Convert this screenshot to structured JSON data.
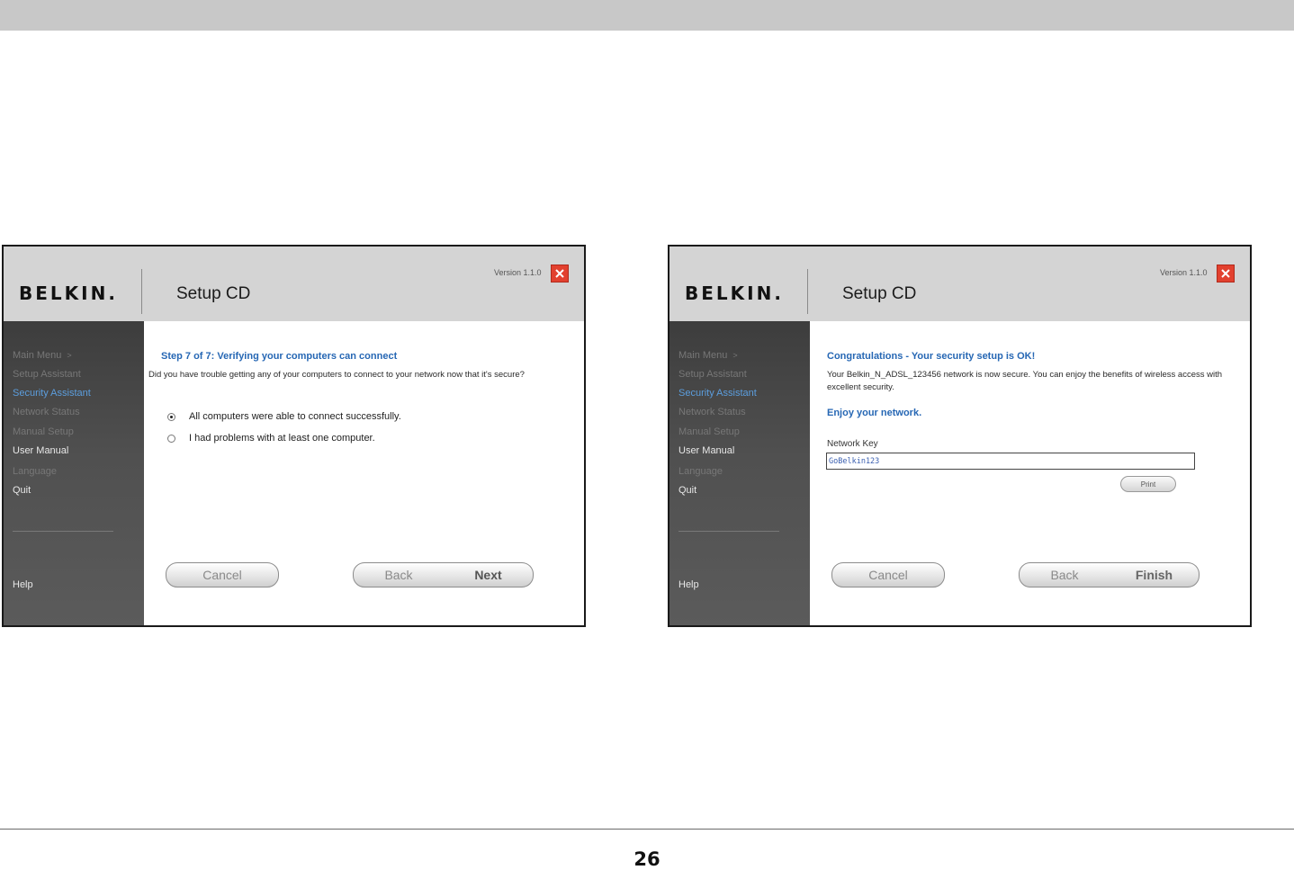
{
  "page_number": "26",
  "windows": [
    {
      "logo": "BELKIN.",
      "title": "Setup CD",
      "version": "Version 1.1.0",
      "sidebar": {
        "items": [
          {
            "label": "Main Menu",
            "arrow": ">"
          },
          {
            "label": "Setup Assistant"
          },
          {
            "label": "Security Assistant"
          },
          {
            "label": "Network Status"
          },
          {
            "label": "Manual Setup"
          },
          {
            "label": "User Manual"
          },
          {
            "label": "Language"
          },
          {
            "label": "Quit"
          }
        ],
        "help": "Help"
      },
      "content": {
        "heading": "Step 7 of 7: Verifying your computers can connect",
        "body": "Did you have trouble getting any of your computers to connect to your network now that it's secure?",
        "options": [
          {
            "label": "All computers were able to connect successfully.",
            "checked": true
          },
          {
            "label": "I had problems with at least one computer.",
            "checked": false
          }
        ]
      },
      "buttons": {
        "cancel": "Cancel",
        "back": "Back",
        "next": "Next"
      }
    },
    {
      "logo": "BELKIN.",
      "title": "Setup CD",
      "version": "Version 1.1.0",
      "sidebar": {
        "items": [
          {
            "label": "Main Menu",
            "arrow": ">"
          },
          {
            "label": "Setup Assistant"
          },
          {
            "label": "Security Assistant"
          },
          {
            "label": "Network Status"
          },
          {
            "label": "Manual Setup"
          },
          {
            "label": "User Manual"
          },
          {
            "label": "Language"
          },
          {
            "label": "Quit"
          }
        ],
        "help": "Help"
      },
      "content": {
        "heading": "Congratulations - Your security setup is OK!",
        "body": "Your Belkin_N_ADSL_123456 network is now secure. You can enjoy the benefits of wireless access with excellent security.",
        "subheading": "Enjoy your network.",
        "network_key_label": "Network Key",
        "network_key_value": "GoBelkin123",
        "print_label": "Print"
      },
      "buttons": {
        "cancel": "Cancel",
        "back": "Back",
        "finish": "Finish"
      }
    }
  ]
}
